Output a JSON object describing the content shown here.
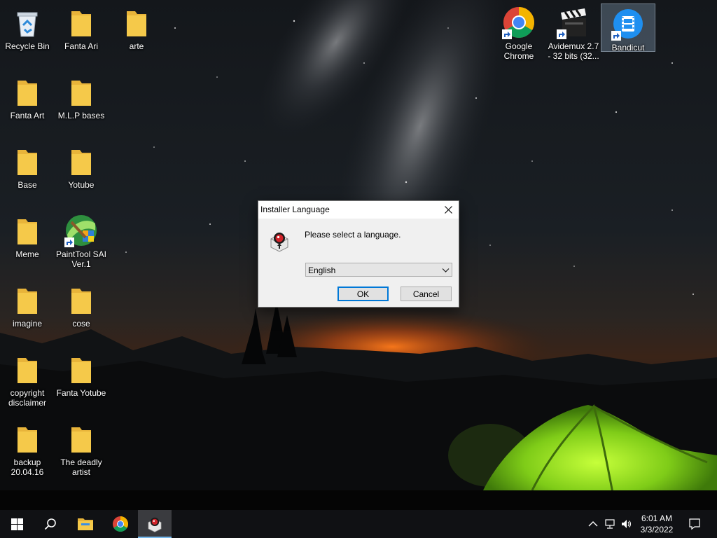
{
  "desktop": {
    "icons": [
      {
        "label": "Recycle Bin"
      },
      {
        "label": "Fanta Ari"
      },
      {
        "label": "arte"
      },
      {
        "label": "Fanta Art"
      },
      {
        "label": "M.L.P bases"
      },
      {
        "label": "Base"
      },
      {
        "label": "Yotube"
      },
      {
        "label": "Meme"
      },
      {
        "label": "PaintTool SAI Ver.1"
      },
      {
        "label": "imagine"
      },
      {
        "label": "cose"
      },
      {
        "label": "copyright disclaimer"
      },
      {
        "label": "Fanta Yotube"
      },
      {
        "label": "backup 20.04.16"
      },
      {
        "label": "The deadly artist"
      },
      {
        "label": "Google Chrome"
      },
      {
        "label": "Avidemux 2.7 - 32 bits (32..."
      },
      {
        "label": "Bandicut"
      }
    ]
  },
  "dialog": {
    "title": "Installer Language",
    "prompt": "Please select a language.",
    "language_select": {
      "selected": "English"
    },
    "ok_label": "OK",
    "cancel_label": "Cancel"
  },
  "taskbar": {
    "pinned": [
      "start-icon",
      "search-icon",
      "file-explorer-icon",
      "chrome-icon",
      "bandicut-installer-icon"
    ],
    "tray": [
      "chevron-up-icon",
      "network-icon",
      "volume-icon",
      "notification-icon"
    ],
    "time": "6:01 AM",
    "date": "3/3/2022"
  },
  "colors": {
    "accent": "#0078d7",
    "taskbar": "#101114",
    "dialog_bg": "#f0f0f0",
    "folder": "#f5c94a"
  }
}
